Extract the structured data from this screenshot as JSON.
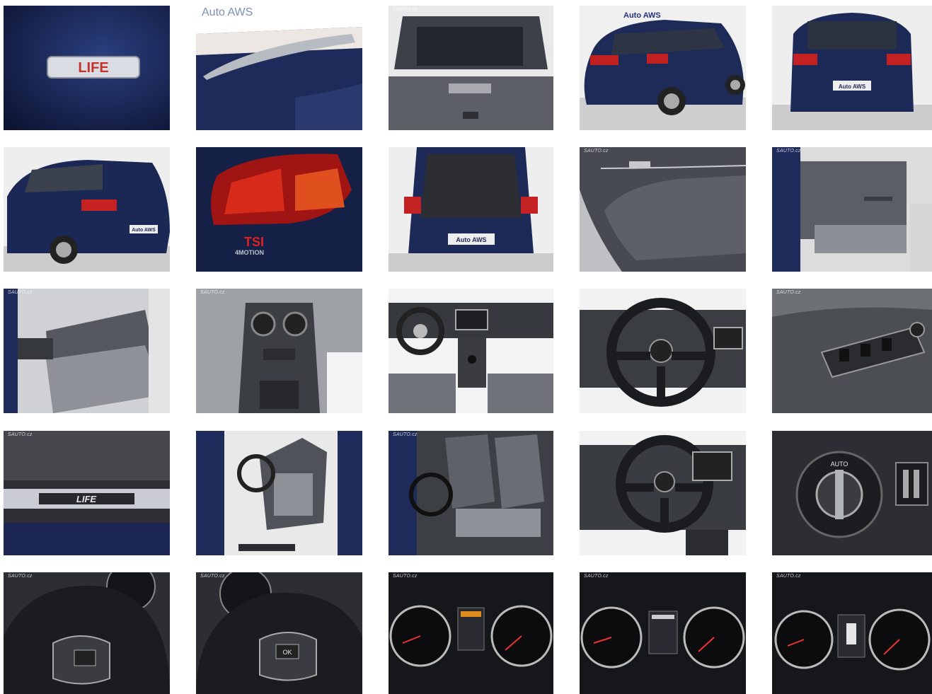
{
  "gallery": {
    "watermark": "SAUTO.cz",
    "photos": [
      {
        "name": "photo-life-badge",
        "badge": "LIFE"
      },
      {
        "name": "photo-roof-rail",
        "brand": "Auto AWS"
      },
      {
        "name": "photo-rear-window-interior"
      },
      {
        "name": "photo-rear-three-quarter",
        "brand": "Auto AWS",
        "plate": "Auto AWS"
      },
      {
        "name": "photo-rear-view",
        "plate": "Auto AWS"
      },
      {
        "name": "photo-rear-left-three-quarter",
        "plate": "Auto AWS"
      },
      {
        "name": "photo-tail-light",
        "badge": "TSI",
        "badge2": "4MOTION"
      },
      {
        "name": "photo-open-trunk",
        "plate": "Auto AWS"
      },
      {
        "name": "photo-rear-door-panel"
      },
      {
        "name": "photo-rear-seats-side"
      },
      {
        "name": "photo-rear-seats-tables"
      },
      {
        "name": "photo-rear-air-vents"
      },
      {
        "name": "photo-dashboard-overview"
      },
      {
        "name": "photo-steering-wheel"
      },
      {
        "name": "photo-window-switches"
      },
      {
        "name": "photo-door-sill",
        "badge": "LIFE"
      },
      {
        "name": "photo-driver-seat"
      },
      {
        "name": "photo-front-seats"
      },
      {
        "name": "photo-steering-dashboard"
      },
      {
        "name": "photo-light-switch",
        "label": "AUTO"
      },
      {
        "name": "photo-steering-controls-left"
      },
      {
        "name": "photo-steering-controls-right",
        "label": "OK"
      },
      {
        "name": "photo-instrument-cluster-1"
      },
      {
        "name": "photo-instrument-cluster-2"
      },
      {
        "name": "photo-instrument-cluster-3"
      }
    ]
  }
}
